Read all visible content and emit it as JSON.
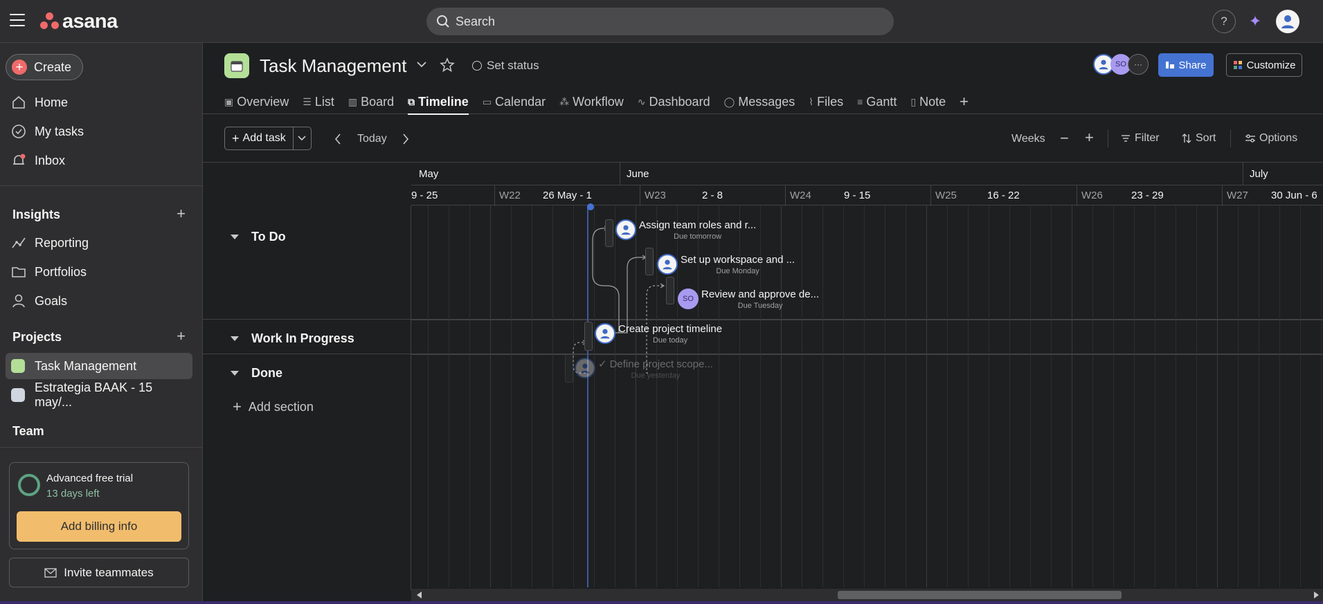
{
  "app": {
    "logo_text": "asana"
  },
  "search": {
    "label": "Search"
  },
  "topbar": {
    "help": "?",
    "sparkle": "✦"
  },
  "sidebar": {
    "create": "Create",
    "nav": [
      "Home",
      "My tasks",
      "Inbox"
    ],
    "insights": {
      "title": "Insights",
      "items": [
        "Reporting",
        "Portfolios",
        "Goals"
      ]
    },
    "projects": {
      "title": "Projects",
      "items": [
        {
          "label": "Task Management",
          "color": "#b3df97"
        },
        {
          "label": "Estrategia BAAK - 15 may/...",
          "color": "#cfd6e0"
        }
      ]
    },
    "team": "Team",
    "trial": {
      "title": "Advanced free trial",
      "days": "13 days left",
      "billing": "Add billing info"
    },
    "invite": "Invite teammates"
  },
  "project": {
    "title": "Task Management",
    "set_status": "Set status",
    "avatar_so": "SO",
    "more": "···",
    "share": "Share",
    "customize": "Customize",
    "tabs": [
      "Overview",
      "List",
      "Board",
      "Timeline",
      "Calendar",
      "Workflow",
      "Dashboard",
      "Messages",
      "Files",
      "Gantt",
      "Note"
    ],
    "active_tab": "Timeline"
  },
  "toolbar": {
    "add_task": "Add task",
    "today": "Today",
    "weeks": "Weeks",
    "filter": "Filter",
    "sort": "Sort",
    "options": "Options"
  },
  "timeline_header": {
    "months": [
      "May",
      "June",
      "July"
    ],
    "weeks": [
      {
        "label": "",
        "range": "9 - 25"
      },
      {
        "label": "W22",
        "range": "26 May - 1"
      },
      {
        "label": "W23",
        "range": "2 - 8"
      },
      {
        "label": "W24",
        "range": "9 - 15"
      },
      {
        "label": "W25",
        "range": "16 - 22"
      },
      {
        "label": "W26",
        "range": "23 - 29"
      },
      {
        "label": "W27",
        "range": "30 Jun - 6"
      }
    ]
  },
  "sections": [
    "To Do",
    "Work In Progress",
    "Done"
  ],
  "add_section": "Add section",
  "tasks": [
    {
      "name": "Assign team roles and r...",
      "due": "Due tomorrow",
      "assignee": "user",
      "section": "To Do"
    },
    {
      "name": "Set up workspace and ...",
      "due": "Due Monday",
      "assignee": "user",
      "section": "To Do"
    },
    {
      "name": "Review and approve de...",
      "due": "Due Tuesday",
      "assignee": "SO",
      "section": "To Do"
    },
    {
      "name": "Create project timeline",
      "due": "Due today",
      "assignee": "user",
      "section": "Work In Progress"
    },
    {
      "name": "Define project scope...",
      "due": "Due yesterday",
      "assignee": "user",
      "section": "Done",
      "check": "✓"
    }
  ]
}
